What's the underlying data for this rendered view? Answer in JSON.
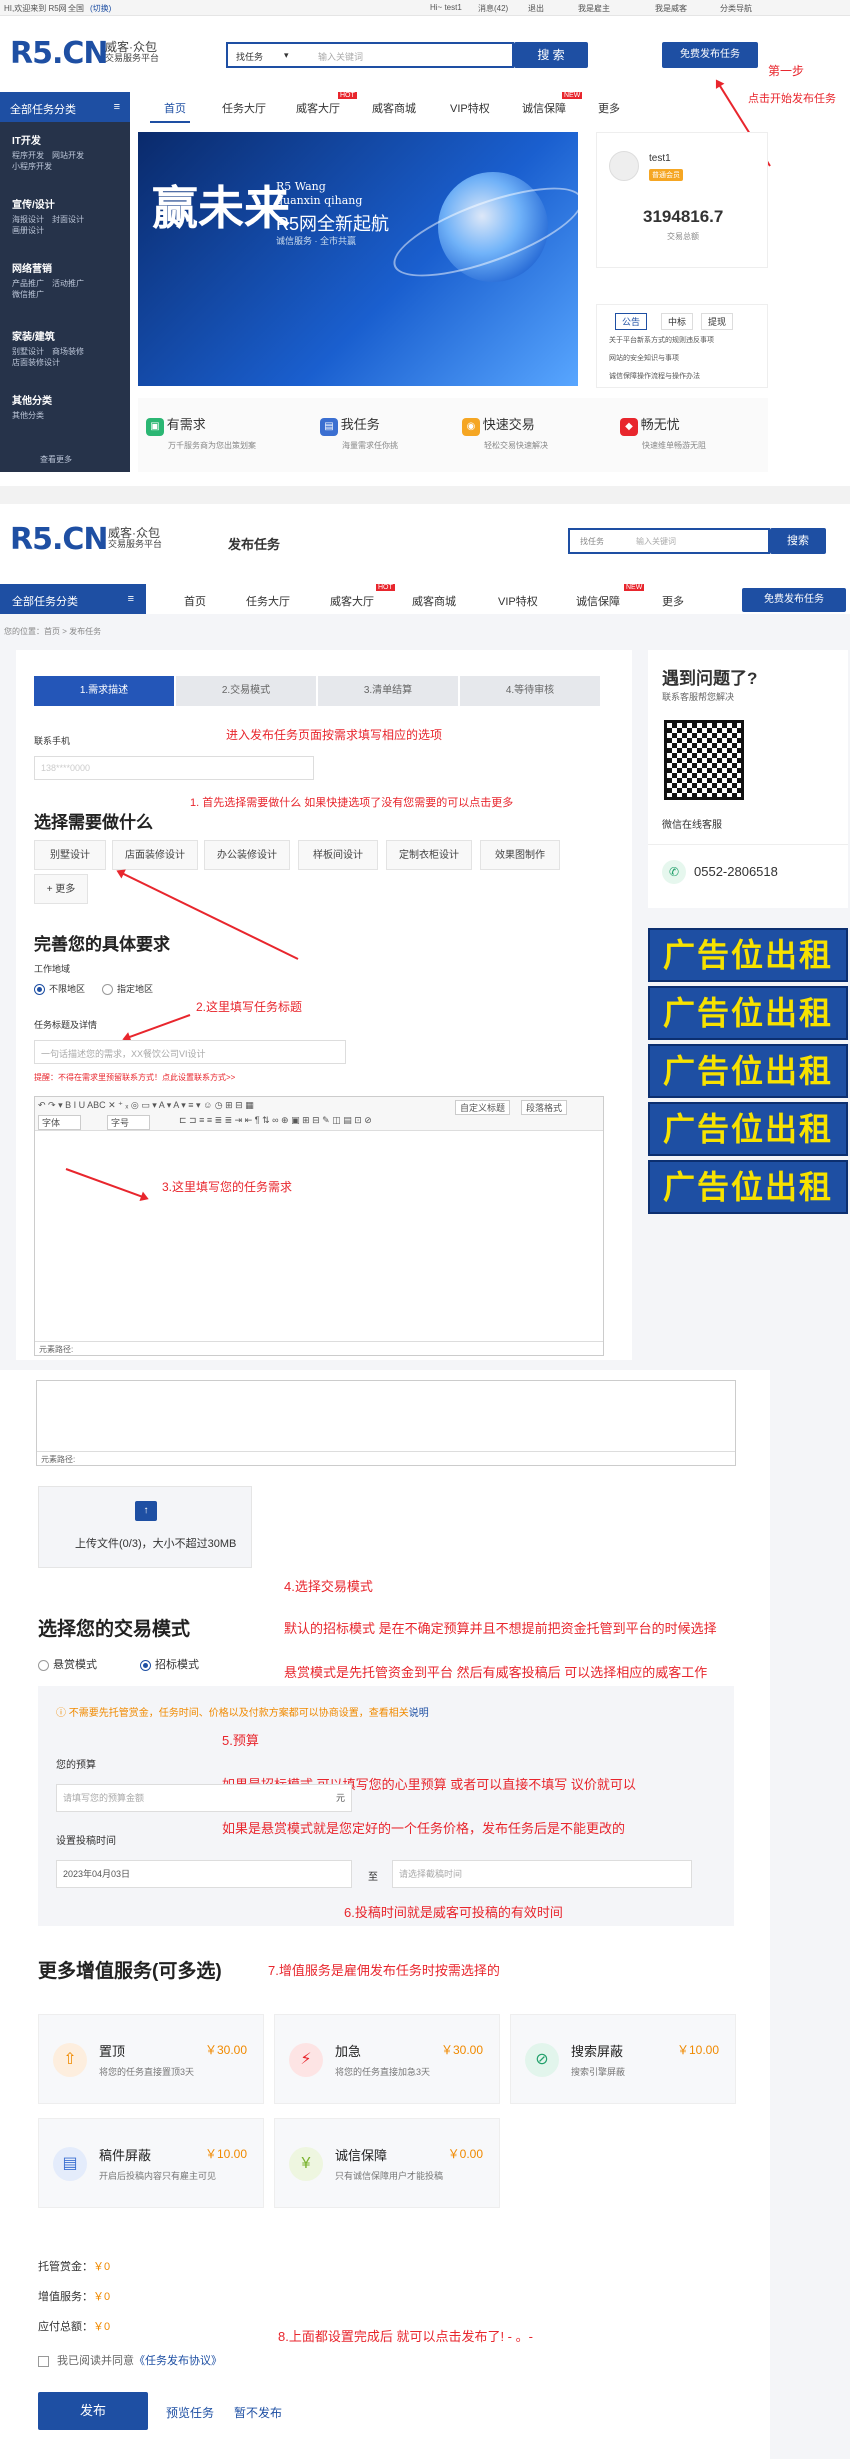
{
  "topbar": {
    "welcome": "HI,欢迎来到 R5网",
    "location": "全国",
    "switch": "(切换)",
    "user": "Hi~ test1",
    "messages": "消息(42)",
    "logout": "退出",
    "employer": "我是雇主",
    "worker": "我是威客",
    "site_nav": "分类导航"
  },
  "brand": {
    "logo": "R5.CN",
    "tagline1": "威客·众包",
    "tagline2": "交易服务平台",
    "color": "#1e4fa3",
    "accent": "#e8262d"
  },
  "search": {
    "scope": "找任务",
    "placeholder": "输入关键词",
    "button": "搜 索",
    "free_post": "免费发布任务"
  },
  "nav": {
    "items": [
      "首页",
      "任务大厅",
      "威客大厅",
      "威客商城",
      "VIP特权",
      "诚信保障",
      "更多"
    ],
    "hot": "HOT",
    "new": "NEW"
  },
  "sidebar": {
    "title": "全部任务分类",
    "groups": [
      {
        "title": "IT开发",
        "items": [
          "程序开发",
          "网站开发",
          "小程序开发"
        ]
      },
      {
        "title": "宣传/设计",
        "items": [
          "海报设计",
          "封面设计",
          "画册设计"
        ]
      },
      {
        "title": "网络营销",
        "items": [
          "产品推广",
          "活动推广",
          "微信推广"
        ]
      },
      {
        "title": "家装/建筑",
        "items": [
          "别墅设计",
          "商场装修",
          "店面装修设计"
        ]
      },
      {
        "title": "其他分类",
        "items": [
          "其他分类"
        ]
      }
    ],
    "more": "查看更多"
  },
  "banner": {
    "headline": "赢未来",
    "line1": "R5 Wang",
    "line2": "quanxin qihang",
    "line3": "R5网全新起航",
    "line4": "诚信服务 · 全市共赢"
  },
  "profile": {
    "name": "test1",
    "badge": "普通会员",
    "number": "3194816.7",
    "sub": "交易总额"
  },
  "notice": {
    "tabs": [
      "公告",
      "中标",
      "提现"
    ],
    "items": [
      "关于平台新系方式的规则违反事项",
      "网站的安全知识与事项",
      "诚信保障操作流程与操作办法"
    ]
  },
  "quick": [
    {
      "title": "有需求",
      "desc": "万千服务商为您出策划案"
    },
    {
      "title": "我任务",
      "desc": "海量需求任你挑"
    },
    {
      "title": "快速交易",
      "desc": "轻松交易快速解决"
    },
    {
      "title": "畅无忧",
      "desc": "快速维单畅游无阻"
    }
  ],
  "annot": {
    "step1": "第一步",
    "step1b": "点击开始发布任务",
    "a0": "进入发布任务页面按需求填写相应的选项",
    "a1": "1. 首先选择需要做什么  如果快捷选项了没有您需要的可以点击更多",
    "a2": "2.这里填写任务标题",
    "a3": "3.这里填写您的任务需求",
    "a4": "4.选择交易模式",
    "a4b": "默认的招标模式 是在不确定预算并且不想提前把资金托管到平台的时候选择",
    "a4c": "悬赏模式是先托管资金到平台 然后有威客投稿后 可以选择相应的威客工作",
    "a5": "5.预算",
    "a5b": "如果是招标模式 可以填写您的心里预算 或者可以直接不填写 议价就可以",
    "a5c": "如果是悬赏模式就是您定好的一个任务价格，发布任务后是不能更改的",
    "a6": "6.投稿时间就是威客可投稿的有效时间",
    "a7": "7.增值服务是雇佣发布任务时按需选择的",
    "a8": "8.上面都设置完成后 就可以点击发布了!  - 。-"
  },
  "post": {
    "page_title": "发布任务",
    "search_placeholder": "输入关键词",
    "search_scope": "找任务",
    "search_btn": "搜索",
    "breadcrumb": "您的位置：首页 > 发布任务",
    "steps": [
      "1.需求描述",
      "2.交易模式",
      "3.清单结算",
      "4.等待审核"
    ],
    "phone_label": "联系手机",
    "phone_value": "138****0000",
    "what_title": "选择需要做什么",
    "chips": [
      "别墅设计",
      "店面装修设计",
      "办公装修设计",
      "样板间设计",
      "定制衣柜设计",
      "效果图制作"
    ],
    "more": "+ 更多",
    "req_title": "完善您的具体要求",
    "region_label": "工作地域",
    "region_opts": [
      "不限地区",
      "指定地区"
    ],
    "title_label": "任务标题及详情",
    "title_placeholder": "一句话描述您的需求，XX餐饮公司VI设计",
    "warn": "提醒：不得在需求里预留联系方式！点此设置联系方式>>",
    "font_label": "字体",
    "size_label": "字号",
    "custom_title": "自定义标题",
    "para_fmt": "段落格式",
    "path_label": "元素路径:",
    "upload": "上传文件(0/3)，大小不超过30MB",
    "mode_title": "选择您的交易模式",
    "modes": [
      "悬赏模式",
      "招标模式"
    ],
    "mode_note": "不需要先托管赏金，任务时间、价格以及付款方案都可以协商设置，查看相关",
    "mode_link": "说明",
    "budget_label": "您的预算",
    "budget_placeholder": "请填写您的预算金额",
    "budget_unit": "元",
    "time_label": "设置投稿时间",
    "time_start": "2023年04月03日",
    "time_to": "至",
    "time_end_placeholder": "请选择截稿时间",
    "vas_title": "更多增值服务(可多选)",
    "vas": [
      {
        "title": "置顶",
        "price": "￥30.00",
        "desc": "将您的任务直接置顶3天",
        "icon": "arrow-up-icon",
        "color": "#f08a00"
      },
      {
        "title": "加急",
        "price": "￥30.00",
        "desc": "将您的任务直接加急3天",
        "icon": "lightning-icon",
        "color": "#e8262d"
      },
      {
        "title": "搜索屏蔽",
        "price": "￥10.00",
        "desc": "搜索引擎屏蔽",
        "icon": "search-block-icon",
        "color": "#22a06b"
      },
      {
        "title": "稿件屏蔽",
        "price": "￥10.00",
        "desc": "开启后投稿内容只有雇主可见",
        "icon": "document-icon",
        "color": "#3b6fd1"
      },
      {
        "title": "诚信保障",
        "price": "￥0.00",
        "desc": "只有诚信保障用户才能投稿",
        "icon": "yen-icon",
        "color": "#7ab32e"
      }
    ],
    "totals": [
      {
        "label": "托管赏金：",
        "value": "￥0"
      },
      {
        "label": "增值服务：",
        "value": "￥0"
      },
      {
        "label": "应付总额：",
        "value": "￥0"
      }
    ],
    "agree": "我已阅读并同意",
    "agree_link": "《任务发布协议》",
    "publish": "发布",
    "preview": "预览任务",
    "later": "暂不发布"
  },
  "help": {
    "title": "遇到问题了?",
    "sub": "联系客服帮您解决",
    "qr_caption": "微信在线客服",
    "phone": "0552-2806518"
  },
  "ads": [
    "广告位出租",
    "广告位出租",
    "广告位出租",
    "广告位出租",
    "广告位出租"
  ]
}
